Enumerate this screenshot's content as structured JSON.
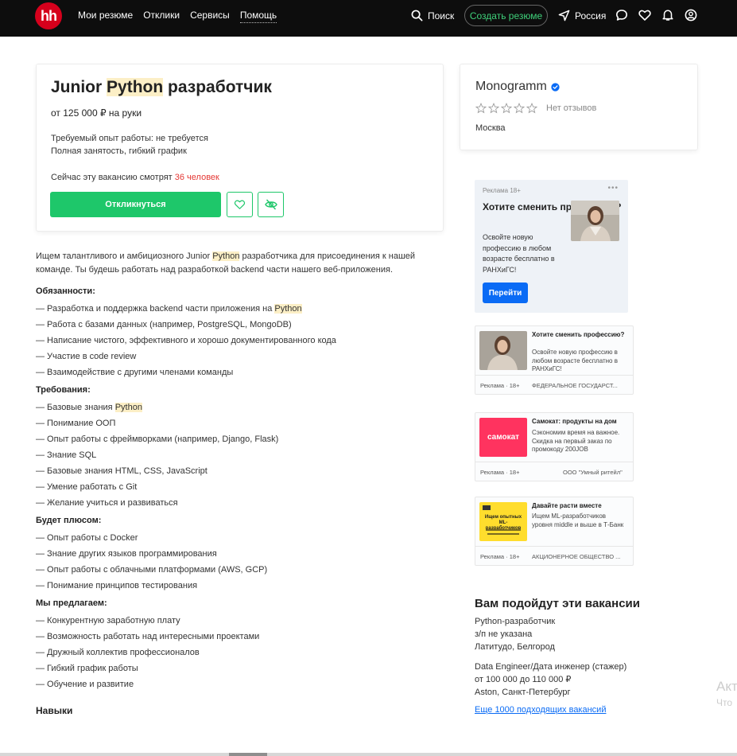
{
  "header": {
    "logo": "hh",
    "nav": [
      "Мои резюме",
      "Отклики",
      "Сервисы",
      "Помощь"
    ],
    "search_label": "Поиск",
    "create_resume_label": "Создать резюме",
    "region_label": "Россия",
    "brand_color": "#d6001c"
  },
  "vacancy": {
    "title_pre": "Junior ",
    "title_hl": "Python",
    "title_post": " разработчик",
    "salary": "от 125 000 ₽ на руки",
    "experience": "Требуемый опыт работы: не требуется",
    "schedule": "Полная занятость, гибкий график",
    "watching_prefix": "Сейчас эту вакансию смотрят ",
    "watching_count": "36 человек",
    "apply_label": "Откликнуться"
  },
  "description": {
    "intro_1": "Ищем талантливого и амбициозного Junior ",
    "intro_hl": "Python",
    "intro_2": " разработчика для присоединения к нашей команде. Ты будешь работать над разработкой backend части нашего веб-приложения.",
    "sections": [
      {
        "title": "Обязанности:",
        "items": [
          {
            "pre": "— Разработка и поддержка backend части приложения на ",
            "hl": "Python",
            "post": ""
          },
          {
            "pre": "— Работа с базами данных (например, PostgreSQL, MongoDB)",
            "hl": "",
            "post": ""
          },
          {
            "pre": "— Написание чистого, эффективного и хорошо документированного кода",
            "hl": "",
            "post": ""
          },
          {
            "pre": "— Участие в code review",
            "hl": "",
            "post": ""
          },
          {
            "pre": "— Взаимодействие с другими членами команды",
            "hl": "",
            "post": ""
          }
        ]
      },
      {
        "title": "Требования:",
        "items": [
          {
            "pre": "— Базовые знания ",
            "hl": "Python",
            "post": ""
          },
          {
            "pre": "— Понимание ООП",
            "hl": "",
            "post": ""
          },
          {
            "pre": "— Опыт работы с фреймворками (например, Django, Flask)",
            "hl": "",
            "post": ""
          },
          {
            "pre": "— Знание SQL",
            "hl": "",
            "post": ""
          },
          {
            "pre": "— Базовые знания HTML, CSS, JavaScript",
            "hl": "",
            "post": ""
          },
          {
            "pre": "— Умение работать с Git",
            "hl": "",
            "post": ""
          },
          {
            "pre": "— Желание учиться и развиваться",
            "hl": "",
            "post": ""
          }
        ]
      },
      {
        "title": "Будет плюсом:",
        "items": [
          {
            "pre": "— Опыт работы с Docker",
            "hl": "",
            "post": ""
          },
          {
            "pre": "— Знание других языков программирования",
            "hl": "",
            "post": ""
          },
          {
            "pre": "— Опыт работы с облачными платформами (AWS, GCP)",
            "hl": "",
            "post": ""
          },
          {
            "pre": "— Понимание принципов тестирования",
            "hl": "",
            "post": ""
          }
        ]
      },
      {
        "title": "Мы предлагаем:",
        "items": [
          {
            "pre": "— Конкурентную заработную плату",
            "hl": "",
            "post": ""
          },
          {
            "pre": "— Возможность работать над интересными проектами",
            "hl": "",
            "post": ""
          },
          {
            "pre": "— Дружный коллектив профессионалов",
            "hl": "",
            "post": ""
          },
          {
            "pre": "— Гибкий график работы",
            "hl": "",
            "post": ""
          },
          {
            "pre": "— Обучение и развитие",
            "hl": "",
            "post": ""
          }
        ]
      }
    ],
    "skills_title": "Навыки"
  },
  "company": {
    "name": "Monogramm",
    "reviews": "Нет отзывов",
    "city": "Москва",
    "rating_stars": 0,
    "verified_color": "#0a6bf5"
  },
  "big_ad": {
    "label": "Реклама 18+",
    "title": "Хотите сменить профессию?",
    "text": "Освойте новую профессию в любом возрасте бесплатно в РАНХиГС!",
    "button": "Перейти"
  },
  "small_ads": [
    {
      "title": "Хотите сменить профессию?",
      "text": "Освойте новую профессию в любом возрасте бесплатно в РАНХиГС!",
      "label": "Реклама · 18+",
      "advertiser": "ФЕДЕРАЛЬНОЕ ГОСУДАРСТ..."
    },
    {
      "title": "Самокат: продукты на дом",
      "text": "Сэкономим время на важное. Скидка на первый заказ по промокоду 200JOB",
      "label": "Реклама · 18+",
      "advertiser": "ООО \"Умный ритейл\"",
      "logo_text": "самокат"
    },
    {
      "title": "Давайте расти вместе",
      "text": "Ищем ML-разработчиков уровня middle и выше в Т-Банк",
      "label": "Реклама · 18+",
      "advertiser": "АКЦИОНЕРНОЕ ОБЩЕСТВО ...",
      "img_heading": "Ищем опытных ML-разработчиков"
    }
  ],
  "suggestions": {
    "title": "Вам подойдут эти вакансии",
    "items": [
      {
        "title": "Python-разработчик",
        "salary": "з/п не указана",
        "company": "Латитудо, Белгород"
      },
      {
        "title": "Data Engineer/Дата инженер (стажер)",
        "salary": "от 100 000 до 110 000 ₽",
        "company": "Aston, Санкт-Петербург"
      }
    ],
    "all_link": "Еще 1000 подходящих вакансий"
  },
  "ghost_text": {
    "line1": "Акт",
    "line2": "Что"
  }
}
